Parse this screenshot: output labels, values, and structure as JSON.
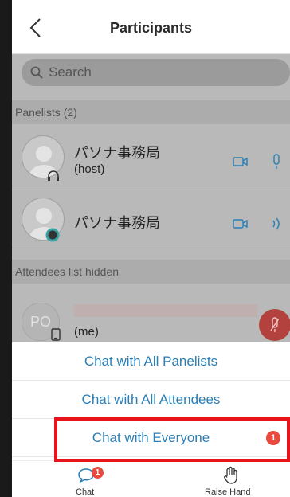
{
  "header": {
    "title": "Participants"
  },
  "search": {
    "placeholder": "Search"
  },
  "panelists": {
    "section_label": "Panelists (2)",
    "items": [
      {
        "name": "パソナ事務局",
        "role": "(host)"
      },
      {
        "name": "パソナ事務局",
        "role": ""
      }
    ]
  },
  "attendees": {
    "section_label": "Attendees list hidden",
    "me": {
      "initials": "PO",
      "label": "(me)"
    }
  },
  "sheet": {
    "options": [
      {
        "label": "Chat with All Panelists"
      },
      {
        "label": "Chat with All Attendees"
      },
      {
        "label": "Chat with Everyone",
        "badge": "1"
      }
    ]
  },
  "tabbar": {
    "chat_label": "Chat",
    "chat_badge": "1",
    "raise_label": "Raise Hand"
  },
  "colors": {
    "accent": "#2a7fb6",
    "badge": "#e84a3e",
    "highlight": "#e8141b",
    "overlay": "#b9b9b9"
  }
}
